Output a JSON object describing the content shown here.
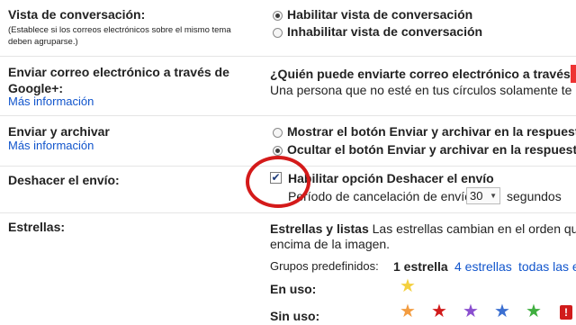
{
  "conversation_view": {
    "label": "Vista de conversación:",
    "hint": "(Establece si los correos electrónicos sobre el mismo tema deben agruparse.)",
    "option_enable": "Habilitar vista de conversación",
    "option_disable": "Inhabilitar vista de conversación"
  },
  "google_plus": {
    "label": "Enviar correo electrónico a través de Google+:",
    "more_info": "Más información",
    "question": "¿Quién puede enviarte correo electrónico a través de",
    "description": "Una persona que no esté en tus círculos solamente te p"
  },
  "send_archive": {
    "label": "Enviar y archivar",
    "more_info": "Más información",
    "option_show": "Mostrar el botón Enviar y archivar en la respuesta",
    "option_hide": "Ocultar el botón Enviar y archivar en la respuesta"
  },
  "undo_send": {
    "label": "Deshacer el envío:",
    "option": "Habilitar opción Deshacer el envío",
    "period_label": "Período de cancelación de envío:",
    "period_value": "30",
    "unit": "segundos"
  },
  "stars": {
    "label": "Estrellas:",
    "title": "Estrellas y listas",
    "description_1": "Las estrellas cambian en el orden que s",
    "description_2": "encima de la imagen.",
    "presets_label": "Grupos predefinidos:",
    "preset_1": "1 estrella",
    "preset_4": "4 estrellas",
    "preset_all": "todas las e",
    "in_use_label": "En uso:",
    "not_in_use_label": "Sin uso:",
    "colors": {
      "yellow": "#f4d03f",
      "orange": "#f39c40",
      "red": "#d11b1b",
      "purple": "#8a4fcf",
      "blue": "#3b6fd1",
      "green": "#3fae3f"
    }
  }
}
